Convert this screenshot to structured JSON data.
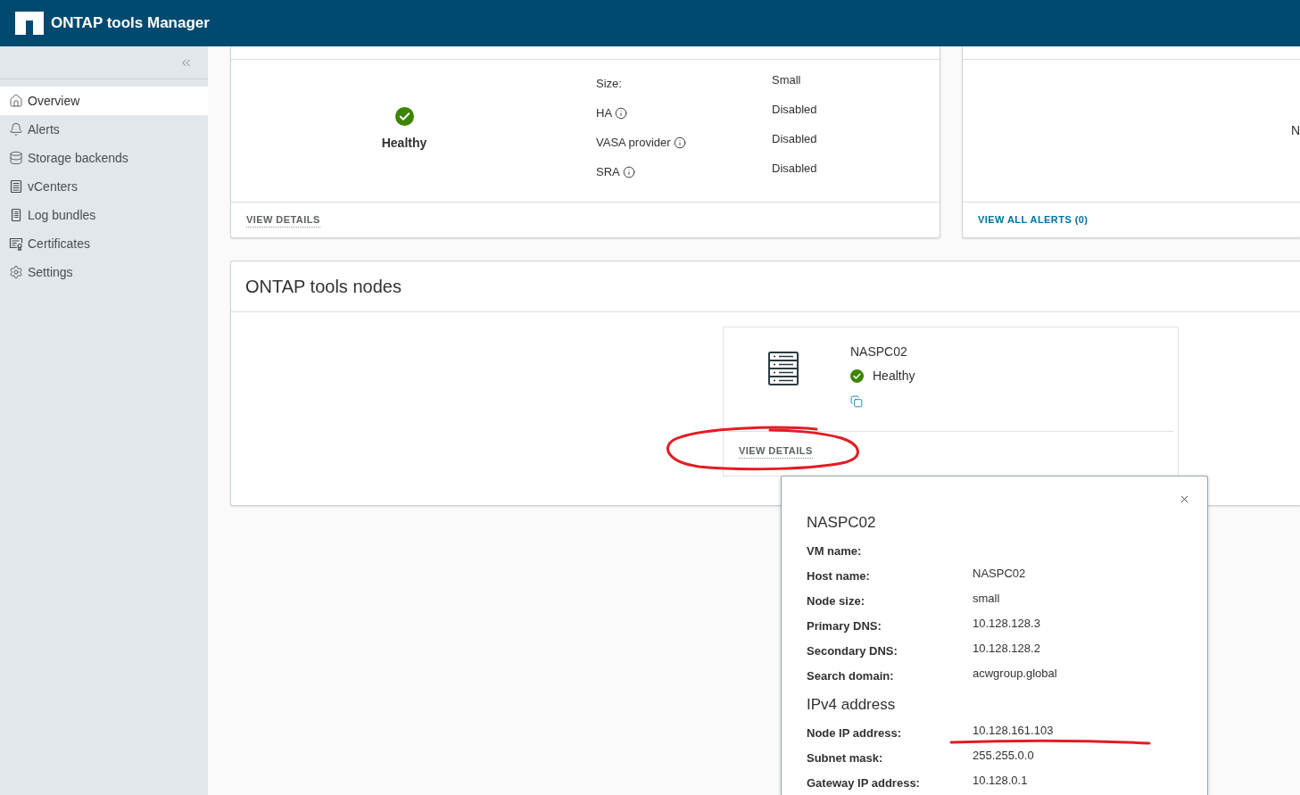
{
  "header": {
    "title": "ONTAP tools Manager"
  },
  "sidebar": {
    "items": [
      {
        "label": "Overview",
        "selected": true
      },
      {
        "label": "Alerts",
        "selected": false
      },
      {
        "label": "Storage backends",
        "selected": false
      },
      {
        "label": "vCenters",
        "selected": false
      },
      {
        "label": "Log bundles",
        "selected": false
      },
      {
        "label": "Certificates",
        "selected": false
      },
      {
        "label": "Settings",
        "selected": false
      }
    ]
  },
  "status_card": {
    "status": "Healthy",
    "properties": [
      {
        "label": "Size:",
        "value": "Small",
        "info": false
      },
      {
        "label": "HA",
        "value": "Disabled",
        "info": true
      },
      {
        "label": "VASA provider",
        "value": "Disabled",
        "info": true
      },
      {
        "label": "SRA",
        "value": "Disabled",
        "info": true
      }
    ],
    "footer_link": "VIEW DETAILS"
  },
  "alerts_card": {
    "text": "N",
    "footer_link": "VIEW ALL ALERTS (0)"
  },
  "nodes_card": {
    "title": "ONTAP tools nodes",
    "nodes": [
      {
        "name": "NASPC02",
        "status": "Healthy",
        "footer_link": "VIEW DETAILS"
      }
    ]
  },
  "node_details": {
    "title": "NASPC02",
    "fields": [
      {
        "label": "VM name:"
      },
      {
        "label": "Host name:",
        "value": "NASPC02"
      },
      {
        "label": "Node size:",
        "value": "small"
      },
      {
        "label": "Primary DNS:",
        "value": "10.128.128.3"
      },
      {
        "label": "Secondary DNS:",
        "value": "10.128.128.2"
      },
      {
        "label": "Search domain:",
        "value": "acwgroup.global"
      }
    ],
    "ipv4_title": "IPv4 address",
    "ipv4_fields": [
      {
        "label": "Node IP address:",
        "value": "10.128.161.103"
      },
      {
        "label": "Subnet mask:",
        "value": "255.255.0.0"
      },
      {
        "label": "Gateway IP address:",
        "value": "10.128.0.1"
      }
    ]
  }
}
